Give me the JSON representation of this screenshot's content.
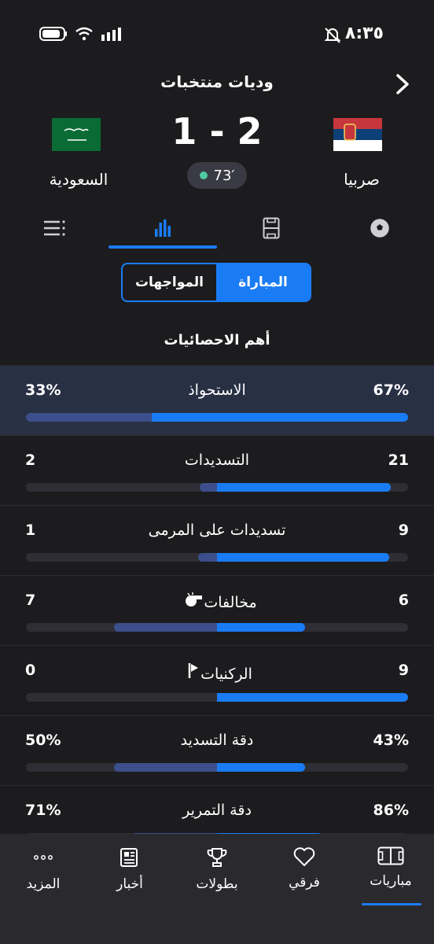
{
  "status_bar": {
    "time": "٨:٣٥"
  },
  "header": {
    "competition": "وديات منتخبات",
    "score": "1 - 2",
    "minute": "73′"
  },
  "teams": {
    "home": "صربيا",
    "away": "السعودية"
  },
  "tabs": [
    {
      "icon": "soccer-ball-icon"
    },
    {
      "icon": "pitch-lineup-icon"
    },
    {
      "icon": "stats-bars-icon",
      "active": true
    },
    {
      "icon": "list-icon"
    }
  ],
  "toggle": {
    "match": "المباراة",
    "h2h": "المواجهات"
  },
  "section_title": "أهم الاحصائيات",
  "stats": [
    {
      "label": "الاستحواذ",
      "right": "67%",
      "left": "33%",
      "right_frac": 0.67,
      "left_frac": 0.33,
      "mode": "split",
      "highlight": true
    },
    {
      "label": "التسديدات",
      "right": "21",
      "left": "2",
      "right_frac": 0.91,
      "left_frac": 0.09,
      "mode": "center"
    },
    {
      "label": "تسديدات على المرمى",
      "right": "9",
      "left": "1",
      "right_frac": 0.9,
      "left_frac": 0.1,
      "mode": "center"
    },
    {
      "label": "مخالفات",
      "right": "6",
      "left": "7",
      "right_frac": 0.46,
      "left_frac": 0.54,
      "mode": "center",
      "icon": "whistle-icon"
    },
    {
      "label": "الركنيات",
      "right": "9",
      "left": "0",
      "right_frac": 1.0,
      "left_frac": 0.0,
      "mode": "center",
      "icon": "corner-flag-icon"
    },
    {
      "label": "دقة التسديد",
      "right": "43%",
      "left": "50%",
      "right_frac": 0.46,
      "left_frac": 0.54,
      "mode": "center"
    },
    {
      "label": "دقة التمرير",
      "right": "86%",
      "left": "71%",
      "right_frac": 0.55,
      "left_frac": 0.45,
      "mode": "center"
    }
  ],
  "bottom_nav": [
    {
      "label": "مباريات",
      "icon": "pitch-icon",
      "active": true
    },
    {
      "label": "فرقي",
      "icon": "heart-icon"
    },
    {
      "label": "بطولات",
      "icon": "trophy-icon"
    },
    {
      "label": "أخبار",
      "icon": "newspaper-icon"
    },
    {
      "label": "المزيد",
      "icon": "more-dots-icon"
    }
  ],
  "colors": {
    "accent": "#1a7cf5",
    "away_bar": "#3c4f8c",
    "live_dot": "#4ec9a0"
  }
}
